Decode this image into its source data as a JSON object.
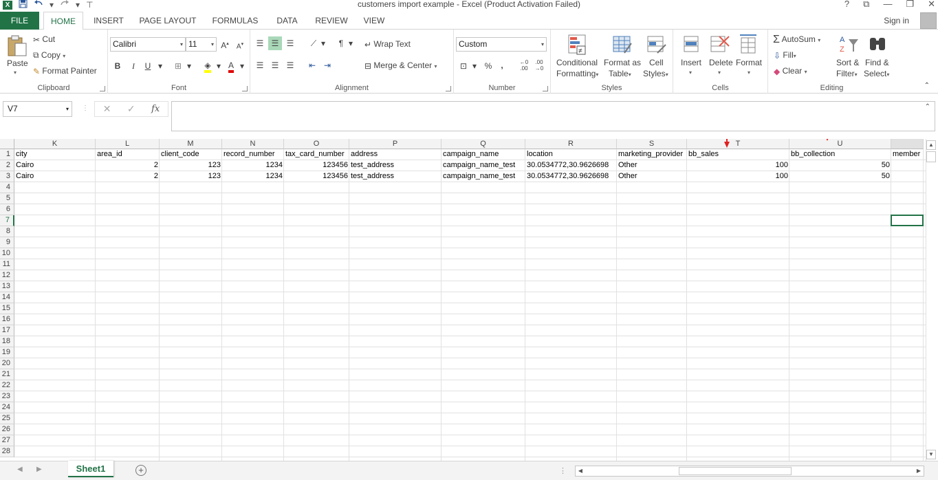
{
  "window": {
    "title": "customers import example - Excel (Product Activation Failed)",
    "controls": [
      "?",
      "⧉",
      "—",
      "❐",
      "✕"
    ]
  },
  "qat": {
    "app_icon": "X",
    "save_icon": "save-icon",
    "undo_icon": "undo-icon",
    "redo_icon": "redo-icon"
  },
  "tabs": [
    "FILE",
    "HOME",
    "INSERT",
    "PAGE LAYOUT",
    "FORMULAS",
    "DATA",
    "REVIEW",
    "VIEW"
  ],
  "signin": "Sign in",
  "ribbon": {
    "clipboard": {
      "label": "Clipboard",
      "paste": "Paste",
      "cut": "Cut",
      "copy": "Copy",
      "format_painter": "Format Painter"
    },
    "font": {
      "label": "Font",
      "name": "Calibri",
      "size": "11",
      "bold": "B",
      "italic": "I",
      "underline": "U"
    },
    "alignment": {
      "label": "Alignment",
      "wrap": "Wrap Text",
      "merge": "Merge & Center"
    },
    "number": {
      "label": "Number",
      "format": "Custom",
      "percent": "%",
      "comma": ",",
      "inc": "+.0 .00",
      "dec": ".00 →.0"
    },
    "styles": {
      "label": "Styles",
      "conditional": "Conditional",
      "conditional2": "Formatting",
      "format_table": "Format as",
      "format_table2": "Table",
      "cell_styles": "Cell",
      "cell_styles2": "Styles"
    },
    "cells": {
      "label": "Cells",
      "insert": "Insert",
      "delete": "Delete",
      "format": "Format"
    },
    "editing": {
      "label": "Editing",
      "autosum": "AutoSum",
      "fill": "Fill",
      "clear": "Clear",
      "sort": "Sort &",
      "sort2": "Filter",
      "find": "Find &",
      "find2": "Select"
    }
  },
  "formula_bar": {
    "name_box": "V7",
    "fx": "fx",
    "cancel": "✕",
    "enter": "✓",
    "value": ""
  },
  "columns": [
    "K",
    "L",
    "M",
    "N",
    "O",
    "P",
    "Q",
    "R",
    "S",
    "T",
    "U"
  ],
  "rows": [
    "1",
    "2",
    "3",
    "4",
    "5",
    "6",
    "7",
    "8",
    "9",
    "10",
    "11",
    "12",
    "13",
    "14",
    "15",
    "16",
    "17",
    "18",
    "19",
    "20",
    "21",
    "22",
    "23",
    "24",
    "25",
    "26",
    "27",
    "28"
  ],
  "headers": [
    "city",
    "area_id",
    "client_code",
    "record_number",
    "tax_card_number",
    "address",
    "campaign_name",
    "location",
    "marketing_provider",
    "bb_sales",
    "bb_collection",
    "member"
  ],
  "data_rows": [
    [
      "Cairo",
      "2",
      "123",
      "1234",
      "123456",
      "test_address",
      "campaign_name_test",
      "30.0534772,30.9626698",
      "Other",
      "100",
      "50"
    ],
    [
      "Cairo",
      "2",
      "123",
      "1234",
      "123456",
      "test_address",
      "campaign_name_test",
      "30.0534772,30.9626698",
      "Other",
      "100",
      "50"
    ]
  ],
  "sheet_tab": "Sheet1",
  "add_sheet": "+",
  "colors": {
    "accent": "#217346",
    "annotation_arrow": "#e02020"
  }
}
